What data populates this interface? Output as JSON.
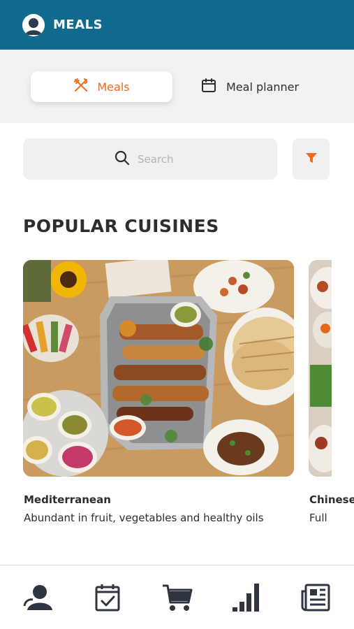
{
  "header": {
    "title": "MEALS"
  },
  "tabs": [
    {
      "label": "Meals",
      "icon": "fork-knife-icon",
      "active": true
    },
    {
      "label": "Meal planner",
      "icon": "calendar-icon",
      "active": false
    }
  ],
  "search": {
    "placeholder": "Search",
    "value": ""
  },
  "section": {
    "title": "POPULAR CUISINES"
  },
  "cuisines": [
    {
      "name": "Mediterranean",
      "description": "Abundant in fruit, vegetables and healthy oils"
    },
    {
      "name": "Chinese",
      "description": "Full"
    }
  ],
  "bottom_nav": [
    {
      "icon": "profile-icon"
    },
    {
      "icon": "calendar-check-icon"
    },
    {
      "icon": "cart-icon"
    },
    {
      "icon": "bar-chart-icon"
    },
    {
      "icon": "news-icon"
    }
  ],
  "colors": {
    "header_bg": "#0f6a8e",
    "accent": "#f26b1d",
    "text": "#2b2d33",
    "tab_band": "#f2f2f2"
  }
}
